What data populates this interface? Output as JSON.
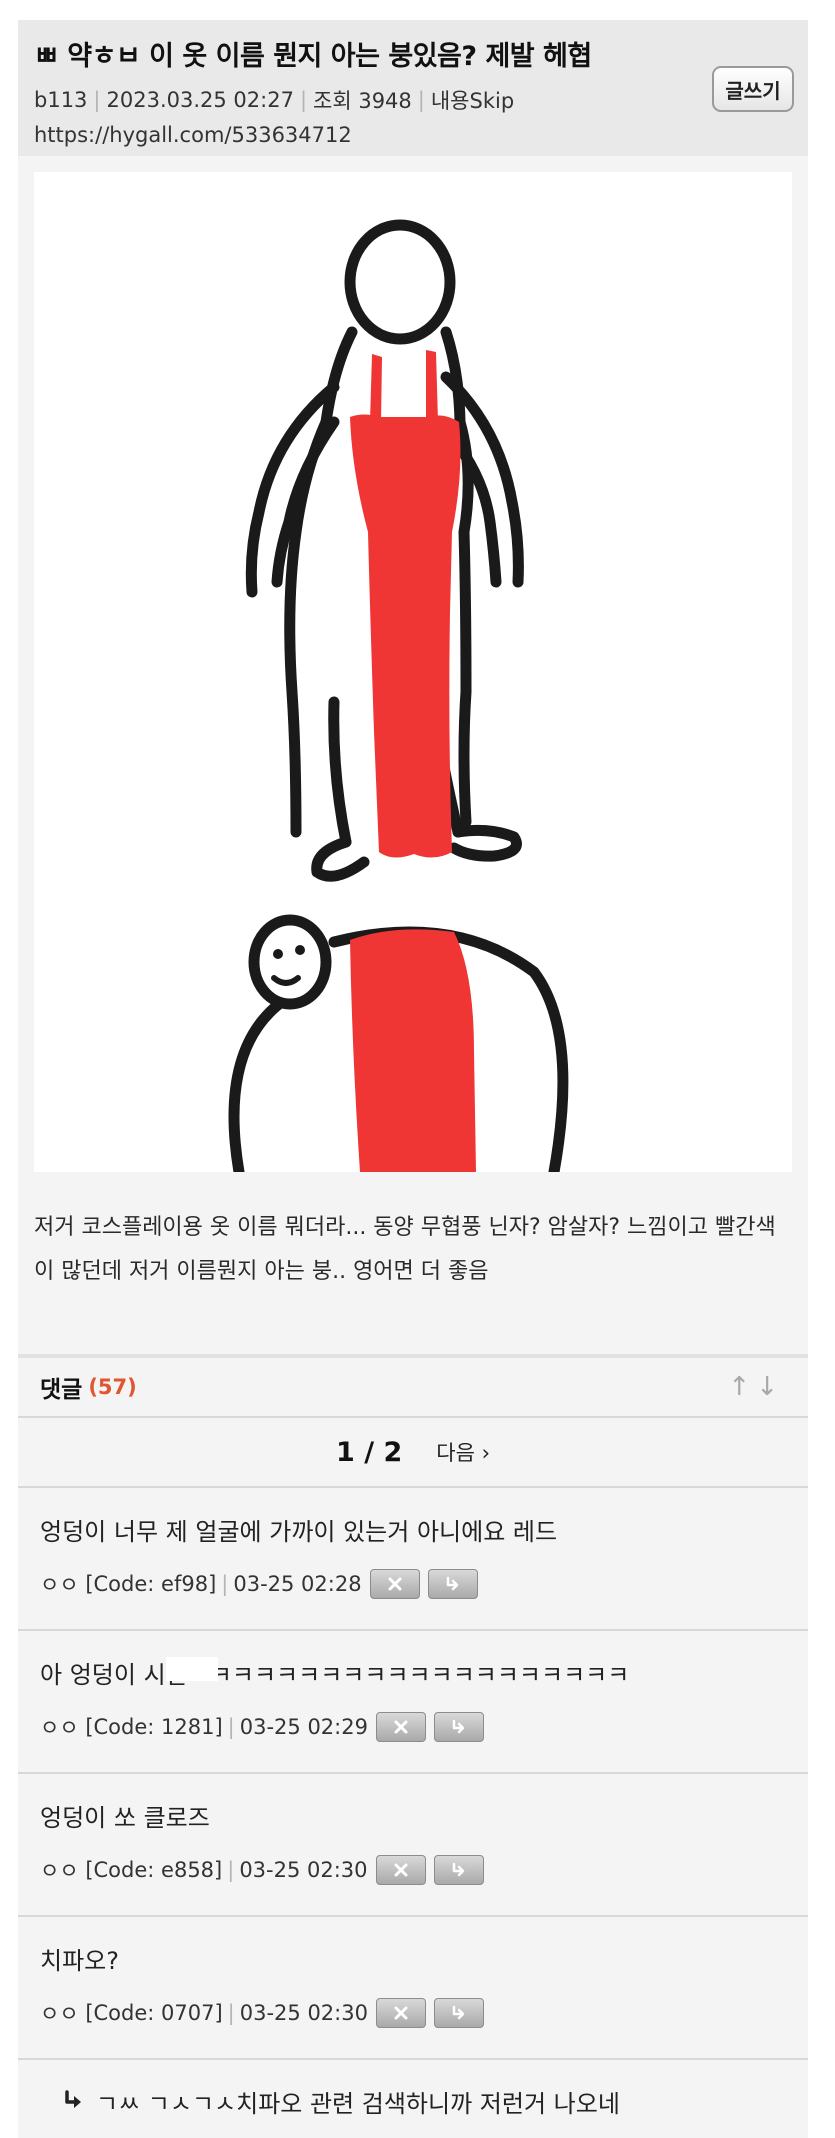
{
  "post": {
    "title": "ㅃ 약ㅎㅂ 이 옷 이름 뭔지 아는 붕있음? 제발 헤협",
    "author": "b113",
    "datetime": "2023.03.25 02:27",
    "views": "조회 3948",
    "content_skip": "내용Skip",
    "url": "https://hygall.com/533634712",
    "write_button": "글쓰기",
    "body": "저거 코스플레이용 옷 이름 뭐더라... 동양 무협풍 닌자? 암살자? 느낌이고 빨간색이 많던데 저거 이름뭔지 아는 붕.. 영어면 더 좋음"
  },
  "comments_section": {
    "label": "댓글",
    "count": "(57)",
    "pager_pages": "1 / 2",
    "pager_next": "다음 ›"
  },
  "comments": [
    {
      "text": "엉덩이 너무 제 얼굴에 가까이 있는거 아니에요 레드",
      "user": "ㅇㅇ",
      "code": "[Code: ef98]",
      "time": "03-25 02:28"
    },
    {
      "text": "아 엉덩이 시발ㅋㅋㅋㅋㅋㅋㅋㅋㅋㅋㅋㅋㅋㅋㅋㅋㅋㅋㅋㅋ",
      "user": "ㅇㅇ",
      "code": "[Code: 1281]",
      "time": "03-25 02:29"
    },
    {
      "text": "엉덩이 쏘 클로즈",
      "user": "ㅇㅇ",
      "code": "[Code: e858]",
      "time": "03-25 02:30"
    },
    {
      "text": "치파오?",
      "user": "ㅇㅇ",
      "code": "[Code: 0707]",
      "time": "03-25 02:30"
    }
  ],
  "reply": {
    "text": "ㄱㅆ ㄱㅅㄱㅅ치파오 관련 검색하니까 저런거 나오네"
  },
  "colors": {
    "header_bg": "#e9e9e9",
    "page_bg": "#f4f4f4",
    "accent_count": "#e0562f",
    "dress_red": "#f03535"
  },
  "icons": [
    "sort-up-icon",
    "sort-down-icon",
    "delete-icon",
    "reply-icon",
    "reply-arrow-icon"
  ]
}
